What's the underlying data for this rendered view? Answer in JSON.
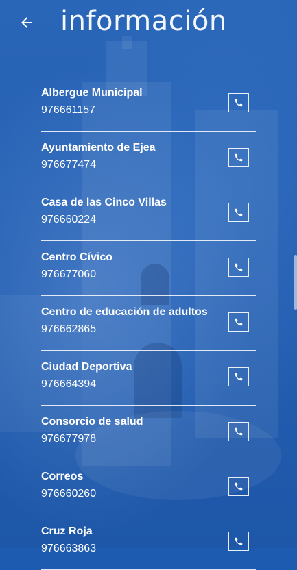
{
  "header": {
    "back_icon": "arrow-left-icon",
    "title": "información"
  },
  "contacts": [
    {
      "name": "Albergue Municipal",
      "phone": "976661157"
    },
    {
      "name": "Ayuntamiento de Ejea",
      "phone": "976677474"
    },
    {
      "name": "Casa de las Cinco Villas",
      "phone": "976660224"
    },
    {
      "name": "Centro Cívico",
      "phone": "976677060"
    },
    {
      "name": "Centro de educación de adultos",
      "phone": "976662865"
    },
    {
      "name": "Ciudad Deportiva",
      "phone": "976664394"
    },
    {
      "name": "Consorcio de salud",
      "phone": "976677978"
    },
    {
      "name": "Correos",
      "phone": "976660260"
    },
    {
      "name": "Cruz Roja",
      "phone": "976663863"
    }
  ],
  "colors": {
    "background": "#1d5bb0",
    "text": "#ffffff"
  },
  "call_icon": "phone-icon"
}
